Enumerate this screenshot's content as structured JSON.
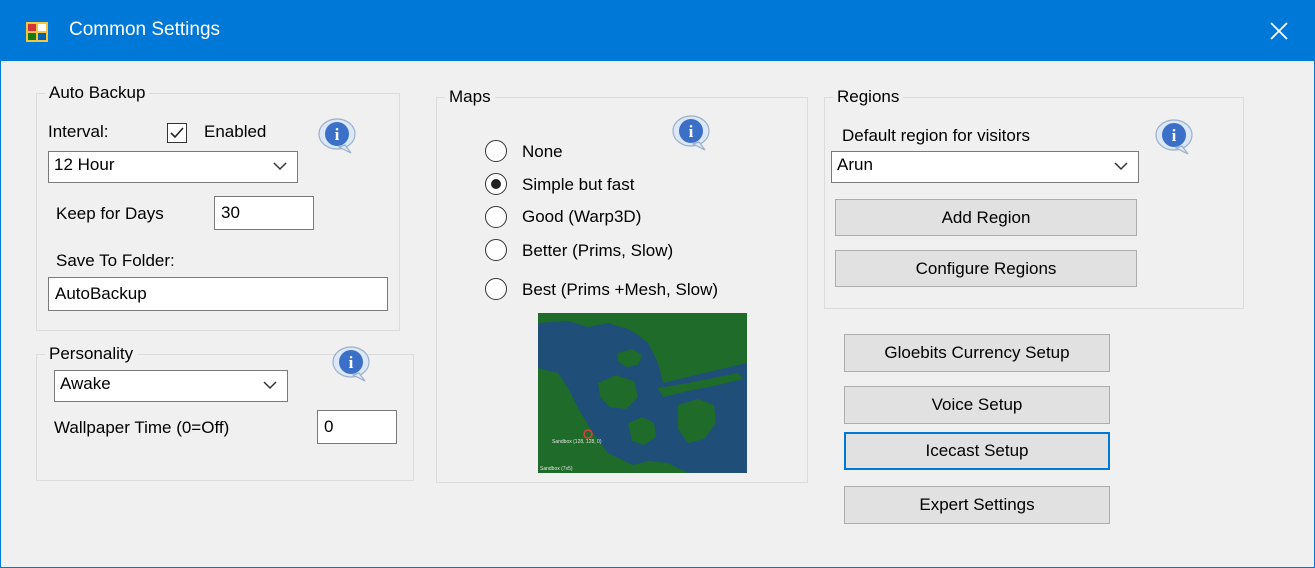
{
  "window": {
    "title": "Common Settings"
  },
  "auto_backup": {
    "group_title": "Auto Backup",
    "interval_label": "Interval:",
    "enabled_label": "Enabled",
    "enabled_checked": true,
    "interval_value": "12 Hour",
    "keep_days_label": "Keep for Days",
    "keep_days_value": "30",
    "save_folder_label": "Save To Folder:",
    "save_folder_value": "AutoBackup"
  },
  "personality": {
    "group_title": "Personality",
    "value": "Awake",
    "wallpaper_label": "Wallpaper Time (0=Off)",
    "wallpaper_value": "0"
  },
  "maps": {
    "group_title": "Maps",
    "options": [
      {
        "label": "None",
        "checked": false
      },
      {
        "label": "Simple but fast",
        "checked": true
      },
      {
        "label": "Good (Warp3D)",
        "checked": false
      },
      {
        "label": "Better (Prims, Slow)",
        "checked": false
      },
      {
        "label": "Best (Prims +Mesh, Slow)",
        "checked": false
      }
    ],
    "preview": {
      "marker_label": "Sandbox (128, 128, 0)",
      "corner_label": "Sandbox (7x5)"
    }
  },
  "regions": {
    "group_title": "Regions",
    "default_region_label": "Default region for visitors",
    "default_region_value": "Arun",
    "add_region_label": "Add Region",
    "configure_regions_label": "Configure Regions"
  },
  "buttons": {
    "gloebits": "Gloebits Currency Setup",
    "voice": "Voice Setup",
    "icecast": "Icecast Setup",
    "expert": "Expert Settings"
  },
  "colors": {
    "titlebar": "#0078d7",
    "window_bg": "#f0f0f0",
    "map_land": "#1e6b2a",
    "map_water": "#1f4e79"
  }
}
